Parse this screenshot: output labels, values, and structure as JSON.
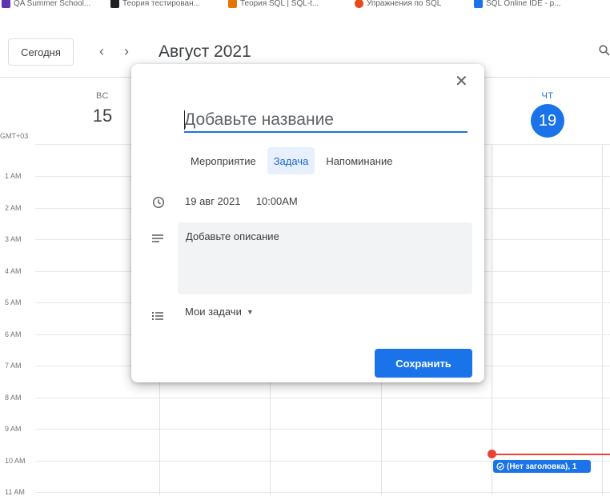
{
  "bookmarks": [
    {
      "label": "QA Summer School...",
      "color": "#5e35b1"
    },
    {
      "label": "Теория тестирован...",
      "color": "#202124"
    },
    {
      "label": "Теория SQL | SQL-t...",
      "color": "#e37400"
    },
    {
      "label": "Упражнения по SQL",
      "color": "#e64a19"
    },
    {
      "label": "SQL Online IDE - p...",
      "color": "#1a73e8"
    }
  ],
  "toolbar": {
    "today_label": "Сегодня",
    "prev_icon": "chevron-left-icon",
    "next_icon": "chevron-right-icon",
    "month_title": "Август 2021",
    "search_icon": "search-icon"
  },
  "days": [
    {
      "dow": "ВС",
      "num": "15",
      "today": false
    },
    {
      "dow": "ЧТ",
      "num": "19",
      "today": true
    }
  ],
  "timezone": "GMT+03",
  "hours": [
    "1 AM",
    "2 AM",
    "3 AM",
    "4 AM",
    "5 AM",
    "6 AM",
    "7 AM",
    "8 AM",
    "9 AM",
    "10 AM",
    "11 AM"
  ],
  "event": {
    "label": "(Нет заголовка), 1"
  },
  "dialog": {
    "title_placeholder": "Добавьте название",
    "tabs": [
      {
        "label": "Мероприятие",
        "active": false
      },
      {
        "label": "Задача",
        "active": true
      },
      {
        "label": "Напоминание",
        "active": false
      }
    ],
    "date": "19 авг 2021",
    "time": "10:00AM",
    "description_placeholder": "Добавьте описание",
    "list_name": "Мои задачи",
    "save_label": "Сохранить"
  },
  "colors": {
    "accent": "#1a73e8",
    "now_line": "#ea4335"
  }
}
